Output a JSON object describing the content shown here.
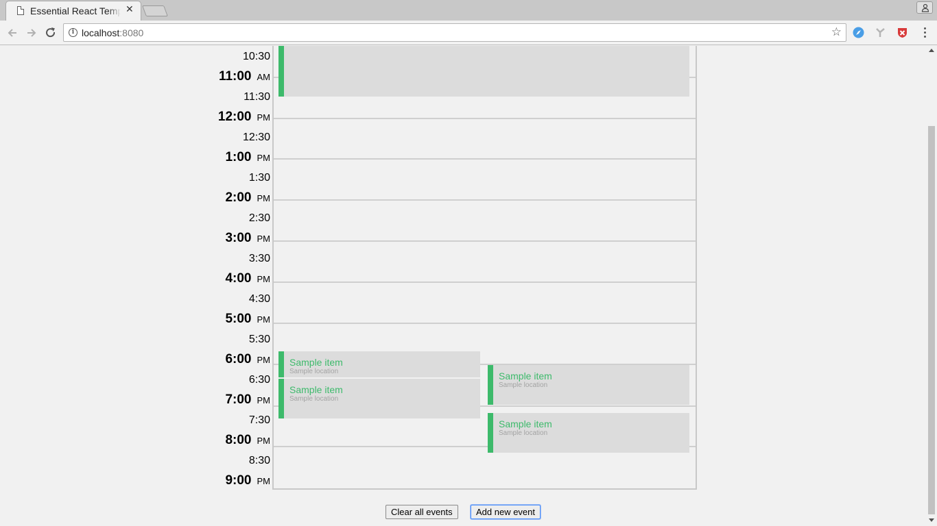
{
  "browser": {
    "tab_title": "Essential React Template",
    "url_host": "localhost",
    "url_port": ":8080"
  },
  "time_labels": [
    {
      "time": "10:30",
      "period": ""
    },
    {
      "time": "11:00",
      "period": "AM"
    },
    {
      "time": "11:30",
      "period": ""
    },
    {
      "time": "12:00",
      "period": "PM"
    },
    {
      "time": "12:30",
      "period": ""
    },
    {
      "time": "1:00",
      "period": "PM"
    },
    {
      "time": "1:30",
      "period": ""
    },
    {
      "time": "2:00",
      "period": "PM"
    },
    {
      "time": "2:30",
      "period": ""
    },
    {
      "time": "3:00",
      "period": "PM"
    },
    {
      "time": "3:30",
      "period": ""
    },
    {
      "time": "4:00",
      "period": "PM"
    },
    {
      "time": "4:30",
      "period": ""
    },
    {
      "time": "5:00",
      "period": "PM"
    },
    {
      "time": "5:30",
      "period": ""
    },
    {
      "time": "6:00",
      "period": "PM"
    },
    {
      "time": "6:30",
      "period": ""
    },
    {
      "time": "7:00",
      "period": "PM"
    },
    {
      "time": "7:30",
      "period": ""
    },
    {
      "time": "8:00",
      "period": "PM"
    },
    {
      "time": "8:30",
      "period": ""
    },
    {
      "time": "9:00",
      "period": "PM"
    }
  ],
  "events": [
    {
      "title": "",
      "location": ""
    },
    {
      "title": "Sample item",
      "location": "Sample location"
    },
    {
      "title": "Sample item",
      "location": "Sample location"
    },
    {
      "title": "Sample item",
      "location": "Sample location"
    },
    {
      "title": "Sample item",
      "location": "Sample location"
    }
  ],
  "buttons": {
    "clear_label": "Clear all events",
    "add_label": "Add new event"
  },
  "colors": {
    "event_accent": "#3dba6b",
    "event_bg": "#dcdcdc"
  }
}
